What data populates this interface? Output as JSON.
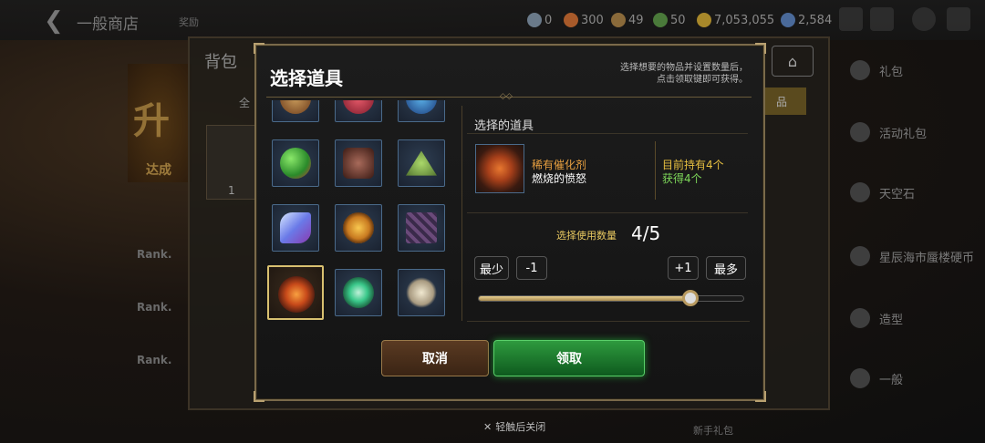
{
  "background": {
    "shop_title": "一般商店",
    "shop_sub": "奖励",
    "currencies": [
      {
        "icon": "gem-icon",
        "value": "0"
      },
      {
        "icon": "fire-coin-icon",
        "value": "300"
      },
      {
        "icon": "feather-icon",
        "value": "49"
      },
      {
        "icon": "leaf-icon",
        "value": "50"
      },
      {
        "icon": "gold-coin-icon",
        "value": "7,053,055"
      },
      {
        "icon": "crystal-icon",
        "value": "2,584"
      }
    ],
    "bag_title": "背包",
    "bag_tab_left": "全",
    "bag_tab_right": "品",
    "bag_slot_count": "1",
    "promo_big": "升",
    "promo_small": "达成",
    "ranks": [
      "Rank.",
      "Rank.",
      "Rank."
    ],
    "side_menu": [
      "礼包",
      "活动礼包",
      "天空石",
      "星辰海市蜃楼硬币",
      "造型",
      "一般"
    ],
    "bottom_right_hint": "新手礼包"
  },
  "dialog": {
    "title": "选择道具",
    "hint_line1": "选择想要的物品并设置数量后，",
    "hint_line2": "点击领取键即可获得。",
    "selected_label": "选择的道具",
    "selected_item": {
      "rarity": "稀有催化剂",
      "name": "燃烧的愤怒",
      "held": "目前持有4个",
      "gain": "获得4个"
    },
    "qty_label": "选择使用数量",
    "qty_value": "4/5",
    "qty_fraction": 0.8,
    "btn_min": "最少",
    "btn_minus": "-1",
    "btn_plus": "+1",
    "btn_max": "最多",
    "btn_cancel": "取消",
    "btn_confirm": "领取",
    "close_hint": "轻触后关闭"
  },
  "items": [
    {
      "icon": "scroll-chest-icon",
      "color": "#9a6a3a"
    },
    {
      "icon": "red-gem-cluster-icon",
      "color": "#c83a4a"
    },
    {
      "icon": "blue-crystal-icon",
      "color": "#3a8ac8"
    },
    {
      "icon": "slime-balls-icon",
      "color": "#4ac84a"
    },
    {
      "icon": "ore-pile-icon",
      "color": "#8a5a4a"
    },
    {
      "icon": "green-mound-icon",
      "color": "#7ab04a"
    },
    {
      "icon": "blue-feather-crystal-icon",
      "color": "#6a8ae8"
    },
    {
      "icon": "sun-medal-icon",
      "color": "#e8a030"
    },
    {
      "icon": "purple-slab-icon",
      "color": "#5a3a6a"
    },
    {
      "icon": "burning-fury-icon",
      "color": "#e86a20"
    },
    {
      "icon": "green-compass-icon",
      "color": "#3ac88a"
    },
    {
      "icon": "skull-crossbones-icon",
      "color": "#d8d0b8"
    }
  ]
}
